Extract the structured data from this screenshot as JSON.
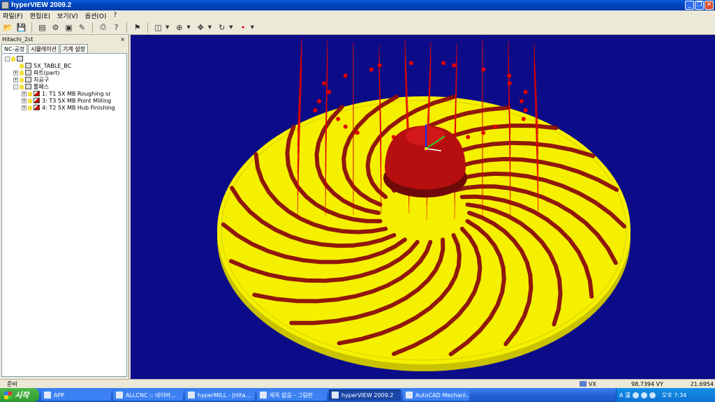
{
  "window": {
    "title": "hyperVIEW 2009.2",
    "buttons": [
      "_",
      "❐",
      "✕"
    ]
  },
  "menu": [
    "파일(F)",
    "편집(E)",
    "보기(V)",
    "옵션(O)",
    "?"
  ],
  "panel": {
    "title": "Hitachi_2st",
    "close": "×",
    "tabs": [
      "NC-공정",
      "시뮬레이션",
      "기계 설정"
    ],
    "tree": [
      {
        "label": "",
        "level": 0,
        "icon": "machine-icon",
        "expander": "-"
      },
      {
        "label": "5X_TABLE_BC",
        "level": 1,
        "icon": "table-icon",
        "expander": ""
      },
      {
        "label": "파트(part)",
        "level": 1,
        "icon": "part-icon",
        "expander": "+"
      },
      {
        "label": "치공구",
        "level": 1,
        "icon": "fixture-icon",
        "expander": "+"
      },
      {
        "label": "툴패스",
        "level": 1,
        "icon": "toolpath-folder-icon",
        "expander": "-"
      },
      {
        "label": "1: T1 5X MB Roughing sr",
        "level": 2,
        "icon": "job-icon",
        "expander": "+"
      },
      {
        "label": "3: T3 5X MB Point Milling",
        "level": 2,
        "icon": "job-icon",
        "expander": "+"
      },
      {
        "label": "4: T2 5X MB Hub Finishing",
        "level": 2,
        "icon": "job-icon",
        "expander": "+"
      }
    ]
  },
  "status": {
    "ready": "준비",
    "vx_label": "VX",
    "vx_value": "98.7394",
    "vy_label": "VY",
    "vy_value": "21.6954"
  },
  "taskbar": {
    "start": "시작",
    "tasks": [
      {
        "label": "APP",
        "active": false
      },
      {
        "label": "ALLCNC :: 네이버...",
        "active": false
      },
      {
        "label": "hyperMILL - [Hita...",
        "active": false
      },
      {
        "label": "제목 없음 - 그림판",
        "active": false
      },
      {
        "label": "hyperVIEW 2009.2",
        "active": true
      },
      {
        "label": "AutoCAD Mechani...",
        "active": false
      }
    ],
    "tray_ime": "A 漢",
    "clock": "오후 7:34"
  },
  "colors": {
    "viewport_bg": "#0d0c88",
    "part": "#f5f000",
    "blade": "#8a0c0c",
    "hub": "#b60f0f",
    "toolpath": "#e00000"
  }
}
